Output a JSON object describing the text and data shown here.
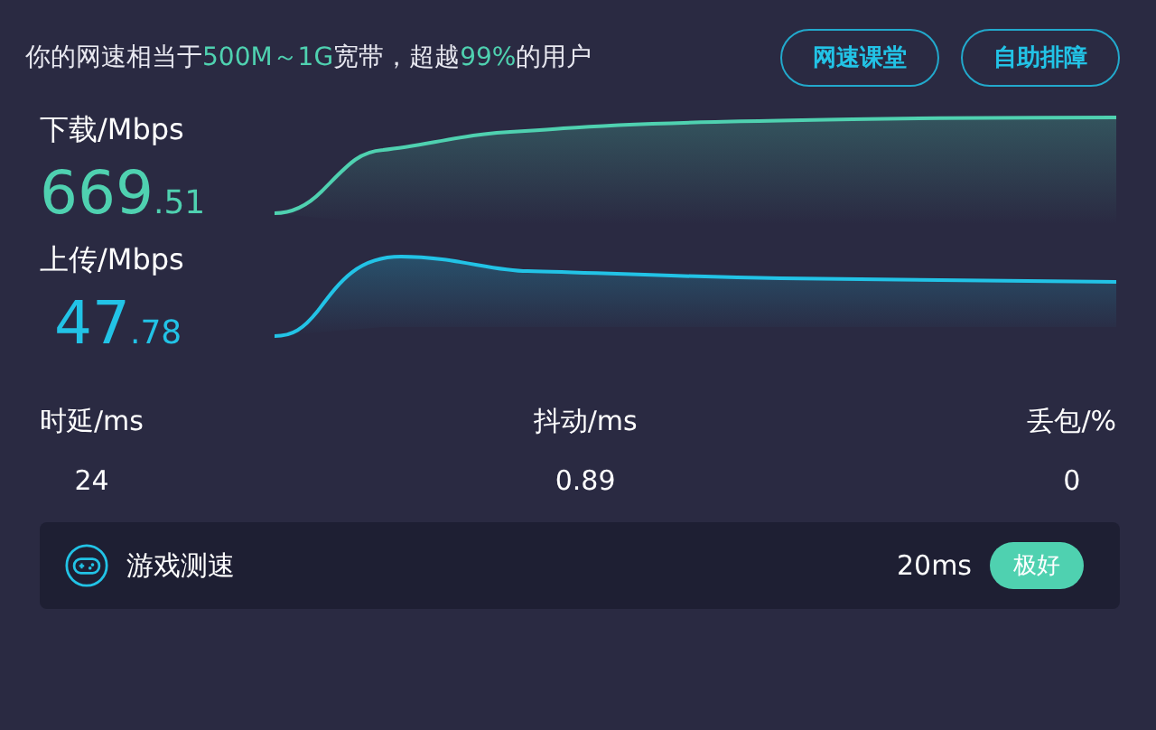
{
  "summary": {
    "segments": [
      {
        "text": "你的网速相当于",
        "highlight": false
      },
      {
        "text": "500M～1G",
        "highlight": true
      },
      {
        "text": "宽带，超越",
        "highlight": false
      },
      {
        "text": "99%",
        "highlight": true
      },
      {
        "text": "的用户",
        "highlight": false
      }
    ]
  },
  "buttons": [
    "网速课堂",
    "自助排障"
  ],
  "speeds": [
    {
      "label": "下载/Mbps",
      "integer": "669",
      "decimal": ".51",
      "color": "#4fd1b0"
    },
    {
      "label": "上传/Mbps",
      "integer": "47",
      "decimal": ".78",
      "color": "#22c3e6"
    }
  ],
  "metrics": [
    {
      "label": "时延/ms",
      "value": "24"
    },
    {
      "label": "抖动/ms",
      "value": "0.89"
    },
    {
      "label": "丢包/%",
      "value": "0"
    }
  ],
  "game": {
    "label": "游戏测速",
    "latency": "20ms",
    "rating": "极好"
  }
}
